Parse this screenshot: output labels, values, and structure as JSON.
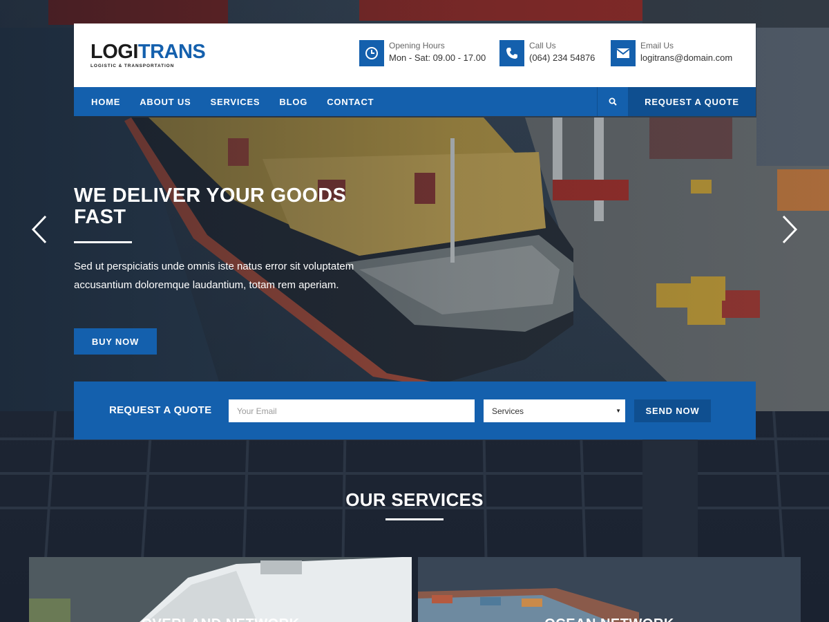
{
  "brand": {
    "logo_part1": "LOGI",
    "logo_part2": "TRANS",
    "tagline": "LOGISTIC & TRANSPORTATION",
    "accent_color": "#1460ad",
    "dark_accent_color": "#0f4f90"
  },
  "header": {
    "opening": {
      "label": "Opening Hours",
      "value": "Mon - Sat: 09.00 - 17.00",
      "icon": "clock-icon"
    },
    "phone": {
      "label": "Call Us",
      "value": "(064) 234 54876",
      "icon": "phone-icon"
    },
    "email": {
      "label": "Email Us",
      "value": "logitrans@domain.com",
      "icon": "envelope-icon"
    }
  },
  "nav": {
    "items": [
      "HOME",
      "ABOUT US",
      "SERVICES",
      "BLOG",
      "CONTACT"
    ],
    "search_icon": "search-icon",
    "quote_button": "REQUEST A QUOTE"
  },
  "hero": {
    "title": "WE DELIVER YOUR GOODS FAST",
    "text": "Sed ut perspiciatis unde omnis iste natus error sit voluptatem accusantium doloremque laudantium, totam rem aperiam.",
    "button": "BUY NOW"
  },
  "quote_form": {
    "label": "REQUEST A QUOTE",
    "email_placeholder": "Your Email",
    "service_selected": "Services",
    "submit": "SEND NOW"
  },
  "services": {
    "title": "OUR SERVICES",
    "cards": [
      {
        "title": "OVERLAND NETWORK"
      },
      {
        "title": "OCEAN NETWORK"
      }
    ]
  }
}
